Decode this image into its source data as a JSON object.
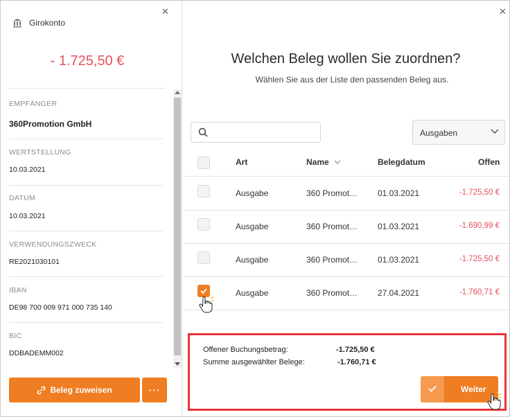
{
  "left_panel": {
    "account_name": "Girokonto",
    "balance": "- 1.725,50 €",
    "fields": [
      {
        "label": "EMPFÄNGER",
        "value": "360Promotion GmbH"
      },
      {
        "label": "WERTSTELLUNG",
        "value": "10.03.2021"
      },
      {
        "label": "DATUM",
        "value": "10.03.2021"
      },
      {
        "label": "VERWENDUNGSZWECK",
        "value": "RE2021030101"
      },
      {
        "label": "IBAN",
        "value": "DE98 700 009 971 000 735 140"
      },
      {
        "label": "BIC",
        "value": "DDBADEMM002"
      }
    ],
    "assign_button": "Beleg zuweisen",
    "more_button": "···"
  },
  "right_panel": {
    "title": "Welchen Beleg wollen Sie zuordnen?",
    "subtitle": "Wählen Sie aus der Liste den passenden Beleg aus.",
    "search_placeholder": "",
    "filter_selected": "Ausgaben",
    "columns": {
      "art": "Art",
      "name": "Name",
      "date": "Belegdatum",
      "open": "Offen"
    },
    "rows": [
      {
        "art": "Ausgabe",
        "name": "360 Promot…",
        "date": "01.03.2021",
        "open": "-1.725,50 €",
        "checked": false
      },
      {
        "art": "Ausgabe",
        "name": "360 Promot…",
        "date": "01.03.2021",
        "open": "-1.690,99 €",
        "checked": false
      },
      {
        "art": "Ausgabe",
        "name": "360 Promot…",
        "date": "01.03.2021",
        "open": "-1.725,50 €",
        "checked": false
      },
      {
        "art": "Ausgabe",
        "name": "360 Promot…",
        "date": "27.04.2021",
        "open": "-1.760,71 €",
        "checked": true
      }
    ],
    "summary": {
      "open_label": "Offener Buchungsbetrag:",
      "open_value": "-1.725,50 €",
      "selected_label": "Summe ausgewählter Belege:",
      "selected_value": "-1.760,71 €"
    },
    "next_button": "Weiter"
  },
  "colors": {
    "accent": "#ef7d22",
    "negative": "#e8505b",
    "highlight": "#e8323a"
  }
}
